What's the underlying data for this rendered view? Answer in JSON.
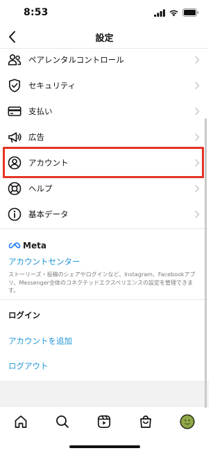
{
  "status_bar": {
    "time": "8:53"
  },
  "header": {
    "title": "設定"
  },
  "menu": {
    "items": [
      {
        "label": "ペアレンタルコントロール",
        "icon": "people-icon"
      },
      {
        "label": "セキュリティ",
        "icon": "shield-icon"
      },
      {
        "label": "支払い",
        "icon": "credit-card-icon"
      },
      {
        "label": "広告",
        "icon": "megaphone-icon"
      },
      {
        "label": "アカウント",
        "icon": "account-circle-icon"
      },
      {
        "label": "ヘルプ",
        "icon": "lifebuoy-icon"
      },
      {
        "label": "基本データ",
        "icon": "info-icon"
      }
    ]
  },
  "meta": {
    "logo_text": "Meta",
    "accounts_center": "アカウントセンター",
    "description": "ストーリーズ・投稿のシェアやログインなど、Instagram、Facebookアプリ、Messenger全体のコネクテッドエクスペリエンスの設定を管理できます。"
  },
  "login": {
    "section_title": "ログイン",
    "add_account": "アカウントを追加",
    "logout": "ログアウト"
  },
  "tabs": [
    "home-icon",
    "search-icon",
    "reels-icon",
    "shop-icon",
    "profile-avatar"
  ],
  "colors": {
    "accent_blue": "#1f94d6",
    "highlight_red": "#e53323"
  }
}
